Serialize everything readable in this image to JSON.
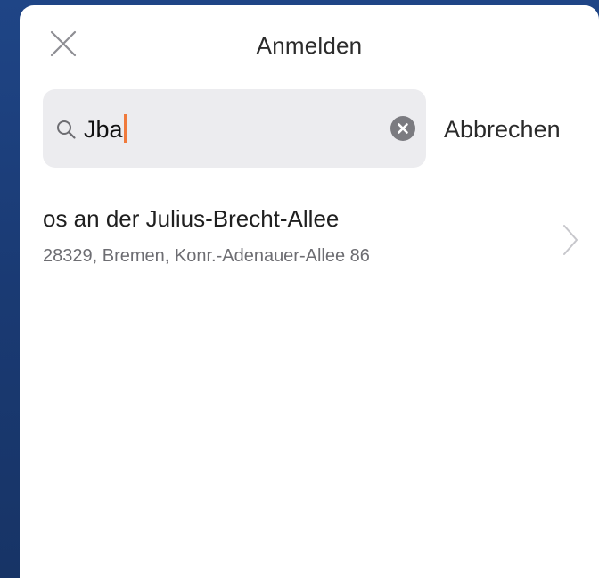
{
  "header": {
    "title": "Anmelden",
    "close_icon": "close-icon"
  },
  "search": {
    "icon": "search-icon",
    "value": "Jba",
    "clear_icon": "clear-circle-icon",
    "cancel_label": "Abbrechen"
  },
  "results": [
    {
      "title": "os an der Julius-Brecht-Allee",
      "subtitle": "28329, Bremen, Konr.-Adenauer-Allee 86",
      "icon": "chevron-right-icon"
    }
  ],
  "colors": {
    "background": "#1c3f7a",
    "sheet": "#ffffff",
    "search_field": "#ececef",
    "caret": "#f07a3c",
    "text_primary": "#1f1f1f",
    "text_secondary": "#6d6d72"
  }
}
